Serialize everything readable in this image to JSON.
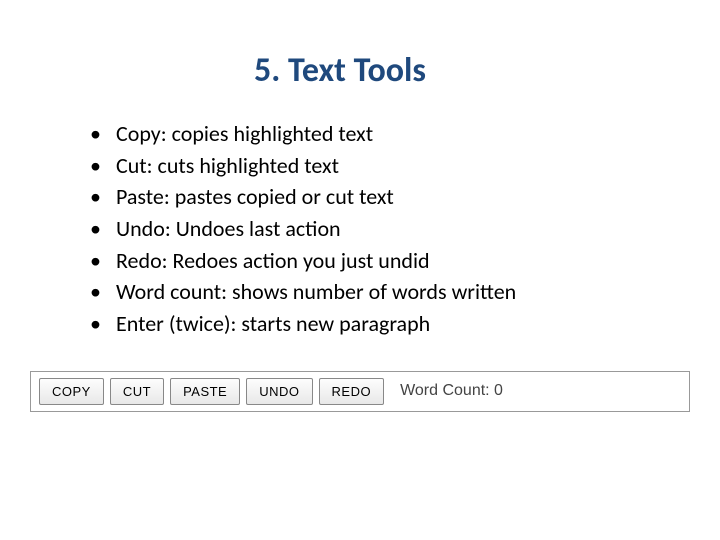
{
  "title": "5. Text Tools",
  "bullets": {
    "0": "Copy: copies highlighted text",
    "1": "Cut: cuts highlighted text",
    "2": "Paste: pastes copied or cut text",
    "3": "Undo: Undoes last action",
    "4": "Redo: Redoes action you just undid",
    "5": "Word count: shows number of words written",
    "6": "Enter (twice): starts new paragraph"
  },
  "toolbar": {
    "copy": "COPY",
    "cut": "CUT",
    "paste": "PASTE",
    "undo": "UNDO",
    "redo": "REDO",
    "wordcount_label": "Word Count: 0"
  }
}
